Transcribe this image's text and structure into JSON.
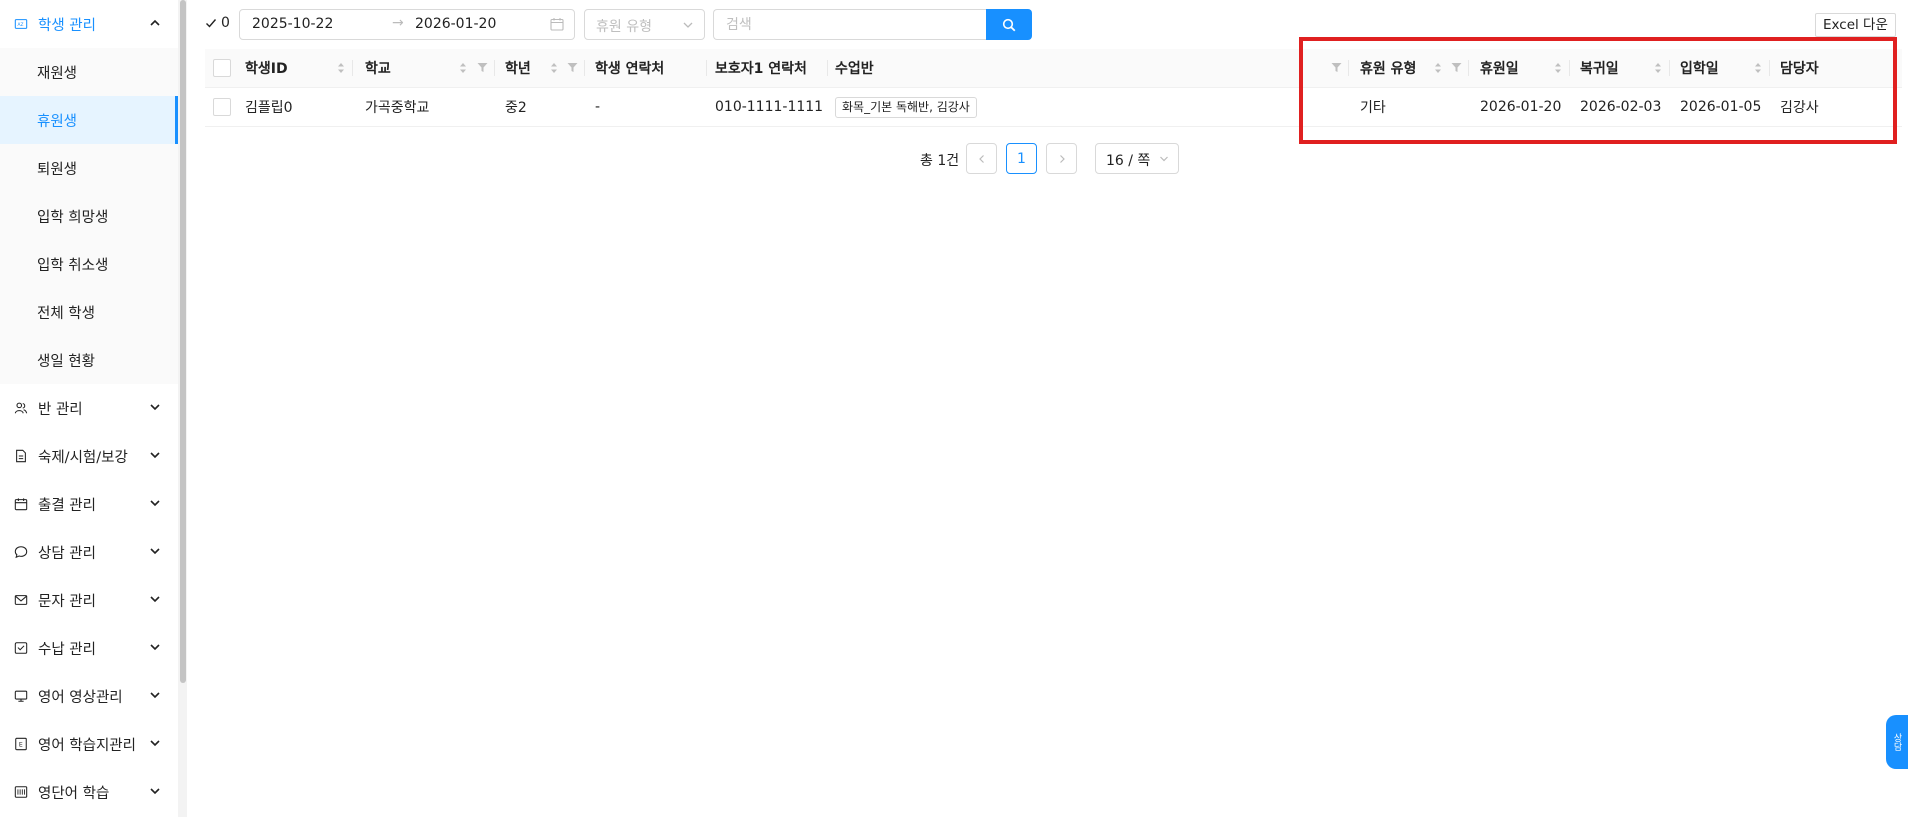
{
  "sidebar": {
    "student_menu": "학생 관리",
    "student_subitems": [
      "재원생",
      "휴원생",
      "퇴원생",
      "입학 희망생",
      "입학 취소생",
      "전체 학생",
      "생일 현황"
    ],
    "groups": [
      "반 관리",
      "숙제/시험/보강",
      "출결 관리",
      "상담 관리",
      "문자 관리",
      "수납 관리",
      "영어 영상관리",
      "영어 학습지관리",
      "영단어 학습"
    ]
  },
  "toolbar": {
    "selected_count": "0",
    "date_from": "2025-10-22",
    "date_to": "2026-01-20",
    "leave_type_placeholder": "휴원 유형",
    "search_placeholder": "검색",
    "excel_label": "Excel 다운"
  },
  "table": {
    "headers": {
      "student_id": "학생ID",
      "school": "학교",
      "grade": "학년",
      "student_phone": "학생 연락처",
      "guardian_phone": "보호자1 연락처",
      "classes": "수업반",
      "leave_type": "휴원 유형",
      "leave_date": "휴원일",
      "return_date": "복귀일",
      "admission_date": "입학일",
      "manager": "담당자"
    },
    "rows": [
      {
        "student_id": "김플립0",
        "school": "가곡중학교",
        "grade": "중2",
        "student_phone": "-",
        "guardian_phone": "010-1111-1111",
        "classes": "화목_기본 독해반, 김강사",
        "leave_type": "기타",
        "leave_date": "2026-01-20",
        "return_date": "2026-02-03",
        "admission_date": "2026-01-05",
        "manager": "김강사"
      }
    ]
  },
  "pagination": {
    "total": "총 1건",
    "current_page": "1",
    "page_size": "16 / 쪽"
  },
  "widget": {
    "label": "상담"
  },
  "colors": {
    "accent": "#1890ff",
    "highlight": "#e02020"
  }
}
